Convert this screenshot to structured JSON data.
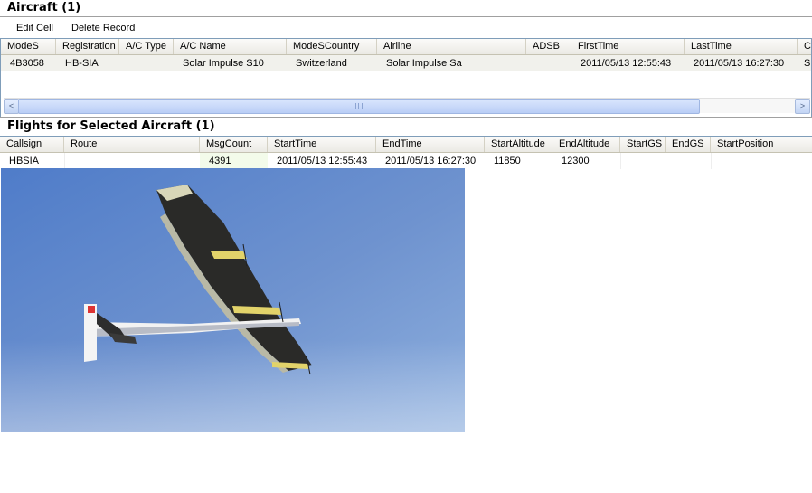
{
  "aircraft_section": {
    "title": "Aircraft (1)",
    "toolbar": {
      "edit_cell": "Edit Cell",
      "delete_record": "Delete Record"
    },
    "columns": [
      "ModeS",
      "Registration",
      "A/C Type",
      "A/C Name",
      "ModeSCountry",
      "Airline",
      "ADSB",
      "FirstTime",
      "LastTime",
      "C"
    ],
    "rows": [
      [
        "4B3058",
        "HB-SIA",
        "",
        "Solar Impulse S10",
        "Switzerland",
        "Solar Impulse Sa",
        "",
        "2011/05/13 12:55:43",
        "2011/05/13 16:27:30",
        "S"
      ]
    ]
  },
  "flights_section": {
    "title": "Flights for Selected Aircraft (1)",
    "columns": [
      "Callsign",
      "Route",
      "MsgCount",
      "StartTime",
      "EndTime",
      "StartAltitude",
      "EndAltitude",
      "StartGS",
      "EndGS",
      "StartPosition"
    ],
    "rows": [
      [
        "HBSIA",
        "",
        "4391",
        "2011/05/13 12:55:43",
        "2011/05/13 16:27:30",
        "11850",
        "12300",
        "",
        "",
        ""
      ]
    ]
  },
  "scrollbar": {
    "left_arrow": "<",
    "right_arrow": ">"
  },
  "photo": {
    "subject": "solar-powered aircraft in flight"
  },
  "colors": {
    "sky": "#6f93cf",
    "grid_border": "#7f9db9",
    "scroll_thumb": "#c7d7f7"
  }
}
